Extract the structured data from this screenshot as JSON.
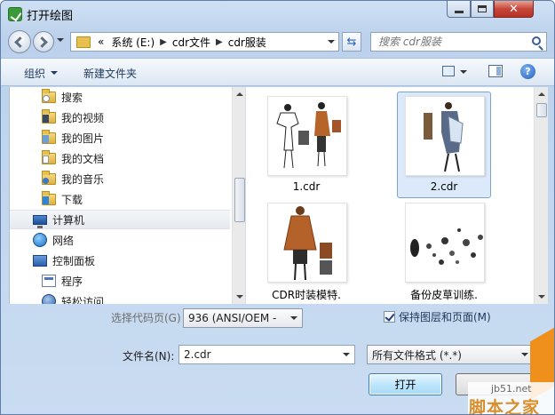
{
  "window": {
    "title": "打开绘图"
  },
  "address": {
    "overflow": "«",
    "segments": [
      "系统 (E:)",
      "cdr文件",
      "cdr服装"
    ]
  },
  "search": {
    "placeholder": "搜索 cdr服装"
  },
  "toolbar": {
    "organize": "组织",
    "new_folder": "新建文件夹",
    "help": "?"
  },
  "nav": {
    "items": [
      {
        "label": "搜索",
        "icon": "search-folder-icon"
      },
      {
        "label": "我的视频",
        "icon": "videos-folder-icon"
      },
      {
        "label": "我的图片",
        "icon": "pictures-folder-icon"
      },
      {
        "label": "我的文档",
        "icon": "documents-folder-icon"
      },
      {
        "label": "我的音乐",
        "icon": "music-folder-icon"
      },
      {
        "label": "下载",
        "icon": "downloads-folder-icon"
      },
      {
        "label": "计算机",
        "icon": "computer-icon"
      },
      {
        "label": "网络",
        "icon": "network-icon"
      },
      {
        "label": "控制面板",
        "icon": "control-panel-icon"
      },
      {
        "label": "程序",
        "icon": "programs-icon"
      },
      {
        "label": "轻松访问",
        "icon": "ease-of-access-icon"
      }
    ]
  },
  "files": [
    {
      "name": "1.cdr",
      "selected": false
    },
    {
      "name": "2.cdr",
      "selected": true
    },
    {
      "name": "CDR时装模特.",
      "selected": false
    },
    {
      "name": "备份皮草训练.",
      "selected": false
    }
  ],
  "bottom": {
    "encoding_label": "选择代码页(G)",
    "encoding_value": "936   (ANSI/OEM -",
    "keep_layers_label": "保持图层和页面(M)",
    "keep_layers_checked": true,
    "filename_label": "文件名(N):",
    "filename_value": "2.cdr",
    "filetype_value": "所有文件格式 (*.*)",
    "open_label": "打开",
    "cancel_label": ""
  },
  "watermark": {
    "url": "jb51.net",
    "text": "脚本之家"
  }
}
